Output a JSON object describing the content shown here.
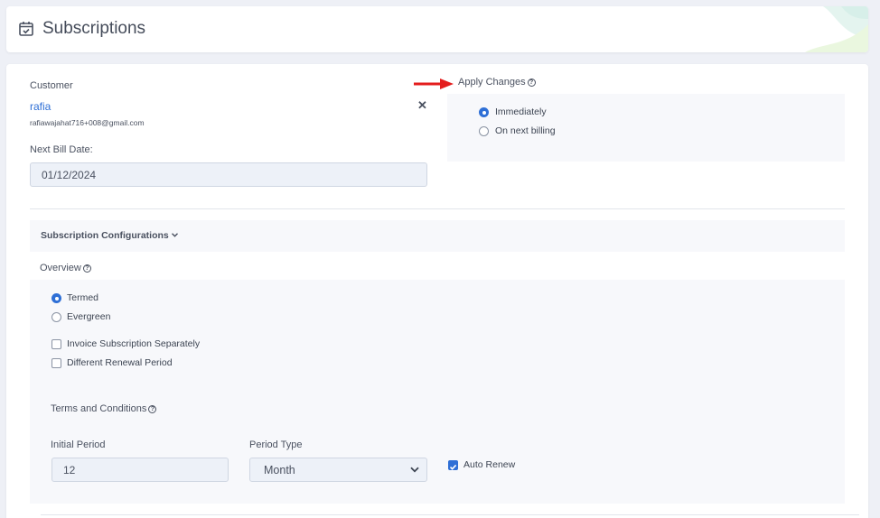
{
  "header": {
    "title": "Subscriptions",
    "icon": "calendar-check-icon"
  },
  "customer": {
    "label": "Customer",
    "name": "rafia",
    "email": "rafiawajahat716+008@gmail.com"
  },
  "next_bill": {
    "label": "Next Bill Date:",
    "value": "01/12/2024"
  },
  "apply_changes": {
    "label": "Apply Changes",
    "options": [
      {
        "label": "Immediately",
        "selected": true
      },
      {
        "label": "On next billing",
        "selected": false
      }
    ]
  },
  "subscription_config": {
    "label": "Subscription Configurations"
  },
  "overview": {
    "label": "Overview",
    "radios": [
      {
        "label": "Termed",
        "selected": true
      },
      {
        "label": "Evergreen",
        "selected": false
      }
    ],
    "checkboxes": [
      {
        "label": "Invoice Subscription Separately",
        "checked": false
      },
      {
        "label": "Different Renewal Period",
        "checked": false
      }
    ]
  },
  "terms": {
    "label": "Terms and Conditions",
    "initial_period": {
      "label": "Initial Period",
      "value": "12"
    },
    "period_type": {
      "label": "Period Type",
      "value": "Month"
    },
    "auto_renew": {
      "label": "Auto Renew",
      "checked": true
    }
  },
  "colors": {
    "accent": "#2e6fd6",
    "panel": "#f7f8fb",
    "arrow": "#e41d1d"
  }
}
